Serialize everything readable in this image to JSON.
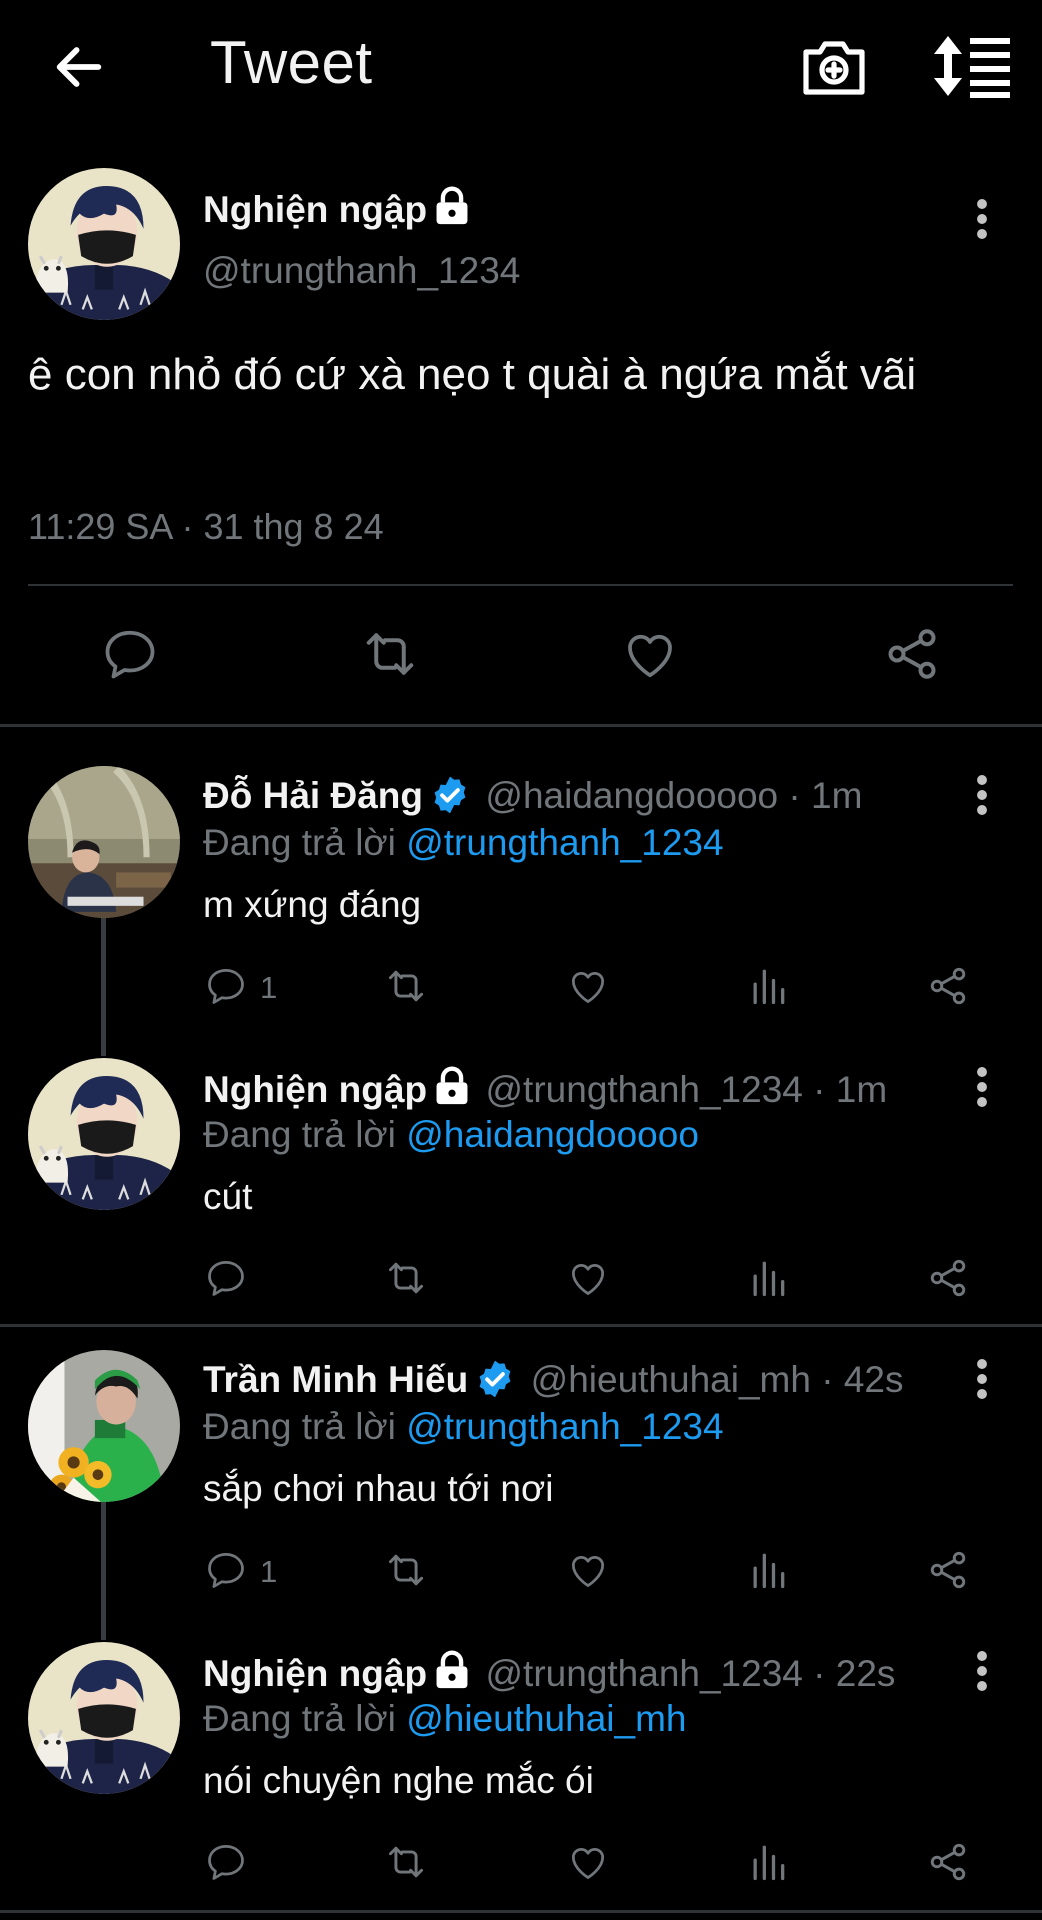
{
  "header": {
    "title": "Tweet"
  },
  "main_tweet": {
    "display_name": "Nghiện ngập",
    "handle": "@trungthanh_1234",
    "text": "ê con nhỏ đó cứ xà nẹo t quài à ngứa mắt vãi",
    "timestamp": "11:29 SA · 31 thg 8 24"
  },
  "replies": [
    {
      "display_name": "Đỗ Hải Đăng",
      "verified": true,
      "handle": "@haidangdooooo · 1m",
      "replying_prefix": "Đang trả lời ",
      "replying_to": "@trungthanh_1234",
      "text": "m xứng đáng",
      "reply_count": "1"
    },
    {
      "display_name": "Nghiện ngập",
      "protected": true,
      "handle": "@trungthanh_1234 · 1m",
      "replying_prefix": "Đang trả lời ",
      "replying_to": "@haidangdooooo",
      "text": "cút",
      "reply_count": ""
    },
    {
      "display_name": "Trần Minh Hiếu",
      "verified": true,
      "handle": "@hieuthuhai_mh · 42s",
      "replying_prefix": "Đang trả lời ",
      "replying_to": "@trungthanh_1234",
      "text": "sắp chơi nhau tới nơi",
      "reply_count": "1"
    },
    {
      "display_name": "Nghiện ngập",
      "protected": true,
      "handle": "@trungthanh_1234 · 22s",
      "replying_prefix": "Đang trả lời ",
      "replying_to": "@hieuthuhai_mh",
      "text": "nói chuyện nghe mắc ói",
      "reply_count": ""
    }
  ],
  "colors": {
    "background": "#000000",
    "text": "#e7e9ea",
    "secondary": "#71767b",
    "accent": "#1d9bf0"
  },
  "icons": [
    "back-arrow-icon",
    "camera-icon",
    "sort-icon",
    "more-icon",
    "lock-icon",
    "verified-badge-icon",
    "reply-icon",
    "retweet-icon",
    "like-icon",
    "views-icon",
    "share-icon"
  ]
}
